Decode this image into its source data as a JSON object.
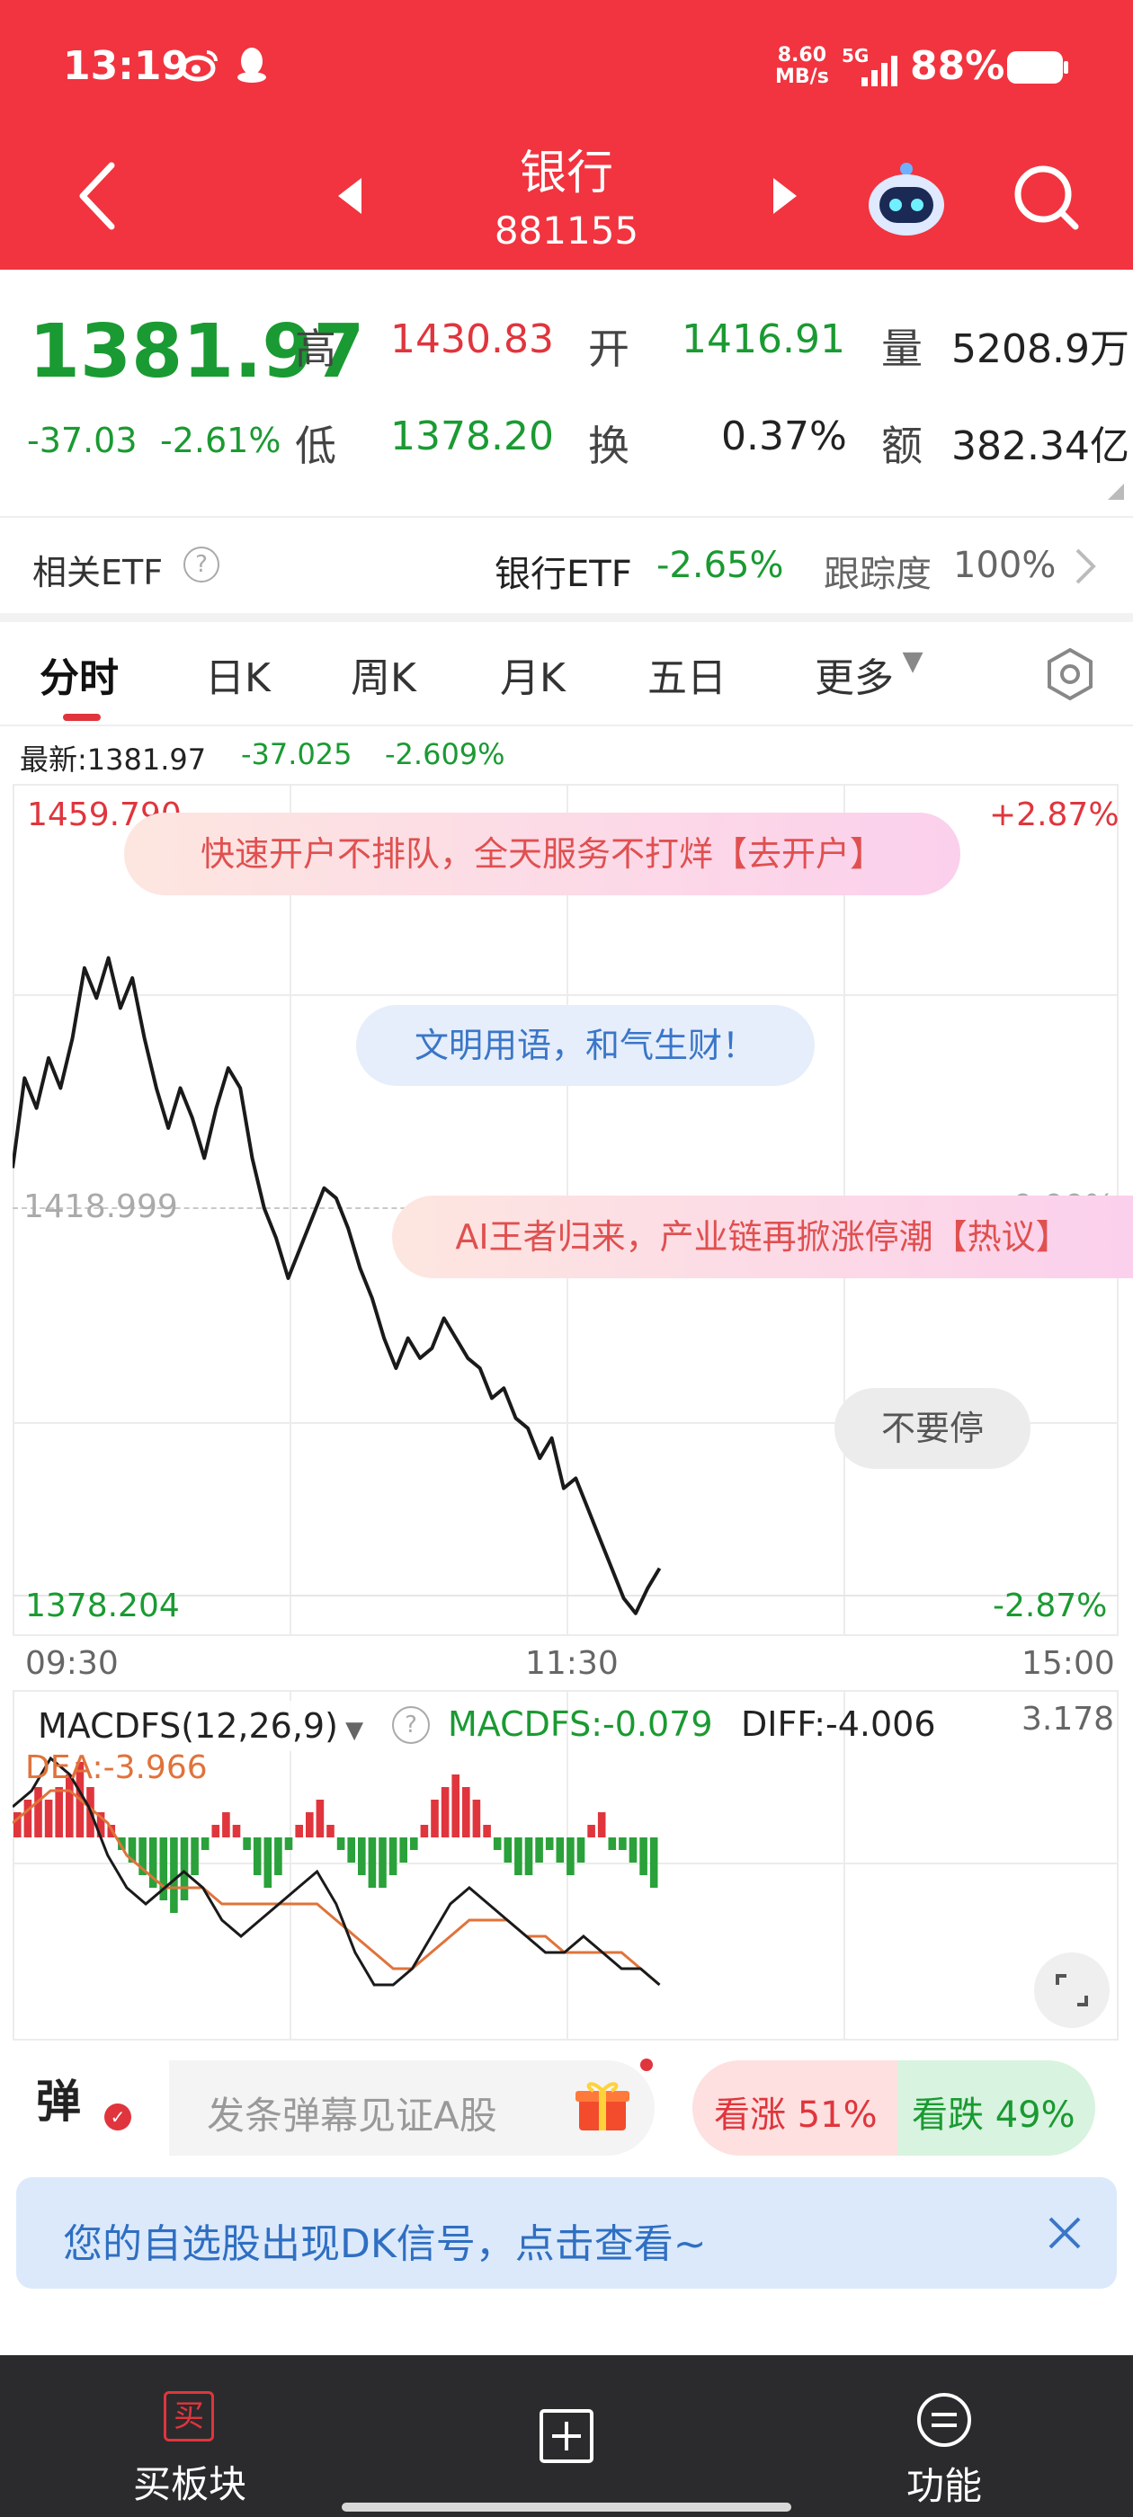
{
  "status_bar": {
    "time": "13:19",
    "net_speed_top": "8.60",
    "net_speed_bottom": "MB/s",
    "signal": "5G",
    "battery": "88%"
  },
  "header": {
    "title": "银行",
    "code": "881155"
  },
  "quote": {
    "price": "1381.97",
    "change": "-37.03",
    "change_pct": "-2.61%",
    "high_label": "高",
    "high": "1430.83",
    "open_label": "开",
    "open": "1416.91",
    "volume_label": "量",
    "volume": "5208.9万",
    "low_label": "低",
    "low": "1378.20",
    "turnover_label": "换",
    "turnover": "0.37%",
    "amount_label": "额",
    "amount": "382.34亿"
  },
  "etf": {
    "label": "相关ETF",
    "name": "银行ETF",
    "change": "-2.65%",
    "tracking_label": "跟踪度",
    "tracking": "100%"
  },
  "tabs": [
    "分时",
    "日K",
    "周K",
    "月K",
    "五日",
    "更多"
  ],
  "latest": {
    "label": "最新:1381.97",
    "change": "-37.025",
    "pct": "-2.609%"
  },
  "chart_data": {
    "type": "line",
    "y_top": "1459.790",
    "y_mid": "1418.999",
    "y_bottom": "1378.204",
    "pct_top": "+2.87%",
    "pct_mid": "0.00%",
    "pct_bottom": "-2.87%",
    "x_labels": [
      "09:30",
      "11:30",
      "15:00"
    ],
    "ylim": [
      1378.204,
      1459.79
    ],
    "values": [
      1423,
      1432,
      1429,
      1434,
      1431,
      1436,
      1443,
      1440,
      1444,
      1439,
      1442,
      1436,
      1431,
      1427,
      1431,
      1428,
      1424,
      1429,
      1433,
      1431,
      1424,
      1419,
      1416,
      1412,
      1415,
      1418,
      1421,
      1420,
      1417,
      1413,
      1410,
      1406,
      1403,
      1406,
      1404,
      1405,
      1408,
      1406,
      1404,
      1403,
      1400,
      1401,
      1398,
      1397,
      1394,
      1396,
      1391,
      1392,
      1389,
      1386,
      1383,
      1380,
      1378.5,
      1381,
      1383
    ]
  },
  "danmaku": {
    "ad1": "快速开户不排队，全天服务不打烊【去开户】",
    "ad2": "文明用语，和气生财！",
    "ad3": "AI王者归来，产业链再掀涨停潮【热议】",
    "ad4": "不要停"
  },
  "macd": {
    "label": "MACDFS(12,26,9)",
    "macdfs_value": "MACDFS:-0.079",
    "diff_value": "DIFF:-4.006",
    "dea_value": "DEA:-3.966",
    "max": "3.178",
    "bars": [
      2,
      3,
      4,
      3,
      4,
      5,
      6,
      4,
      2,
      1,
      -1,
      -2,
      -3,
      -4,
      -5,
      -6,
      -5,
      -3,
      -1,
      1,
      2,
      1,
      -1,
      -3,
      -4,
      -3,
      -1,
      1,
      2,
      3,
      1,
      -1,
      -2,
      -3,
      -4,
      -4,
      -3,
      -2,
      -1,
      1,
      3,
      4,
      5,
      4,
      3,
      1,
      -1,
      -2,
      -3,
      -3,
      -2,
      -1,
      -2,
      -3,
      -2,
      1,
      2,
      -1,
      -1,
      -2,
      -3,
      -4
    ],
    "diff": [
      3,
      4,
      6,
      5,
      3,
      0,
      -2,
      -3,
      -2,
      -1,
      -2,
      -4,
      -5,
      -4,
      -3,
      -2,
      -1,
      -3,
      -6,
      -8,
      -8,
      -7,
      -5,
      -3,
      -2,
      -3,
      -4,
      -5,
      -6,
      -6,
      -5,
      -6,
      -7,
      -7,
      -8
    ],
    "dea": [
      2,
      3,
      4,
      4,
      3,
      2,
      0,
      -1,
      -2,
      -2,
      -2,
      -3,
      -3,
      -3,
      -3,
      -3,
      -3,
      -4,
      -5,
      -6,
      -7,
      -7,
      -6,
      -5,
      -4,
      -4,
      -4,
      -5,
      -5,
      -6,
      -6,
      -6,
      -6,
      -7,
      -8
    ]
  },
  "bottom_bar": {
    "danmu_btn": "弹",
    "input_placeholder": "发条弹幕见证A股",
    "up_label": "看涨 51%",
    "down_label": "看跌 49%",
    "up_pct": 51
  },
  "banner": {
    "text": "您的自选股出现DK信号，点击查看~"
  },
  "nav": {
    "left_icon_text": "买",
    "left_label": "买板块",
    "right_label": "功能"
  }
}
